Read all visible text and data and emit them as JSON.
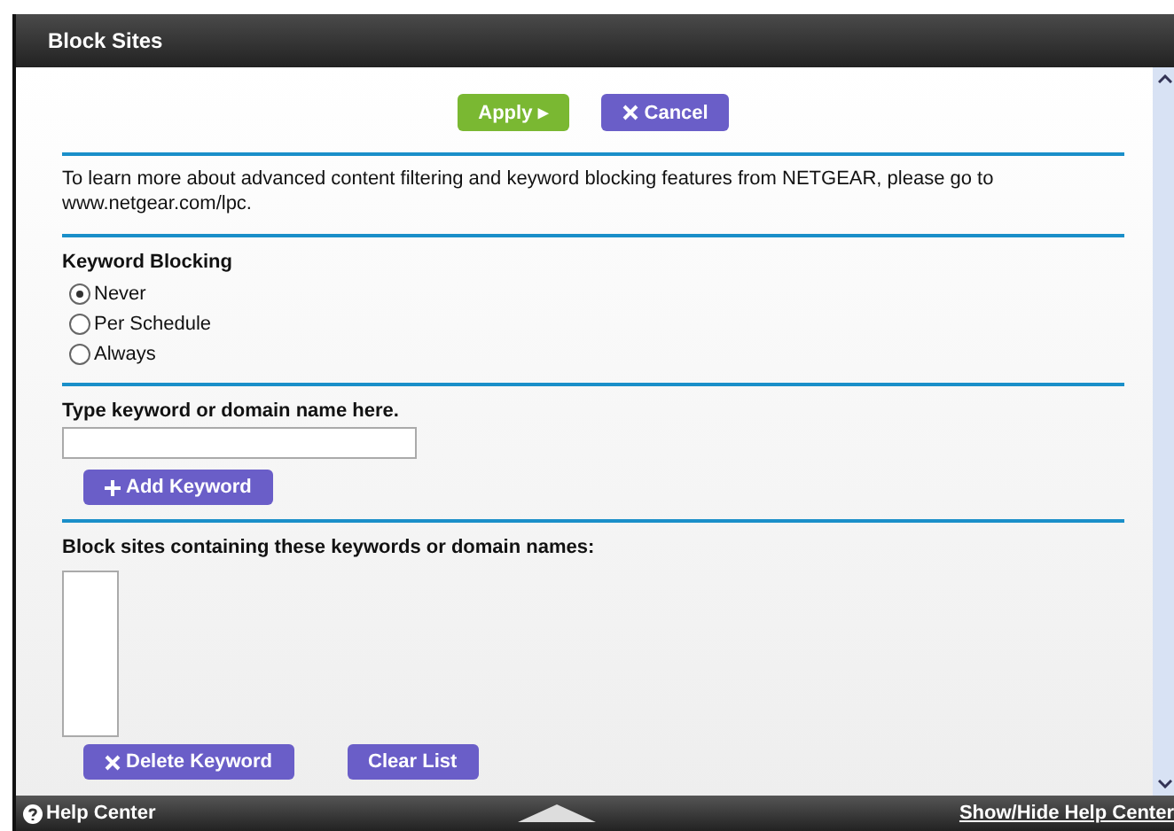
{
  "window": {
    "title": "Block Sites"
  },
  "actions": [
    {
      "label": "Apply ▸",
      "kind": "apply"
    },
    {
      "label": "Cancel",
      "kind": "cancel"
    }
  ],
  "intro": "To learn more about advanced content filtering and keyword blocking features from NETGEAR, please go to www.netgear.com/lpc.",
  "keyword_blocking": {
    "heading": "Keyword Blocking",
    "options": [
      {
        "label": "Never",
        "selected": true
      },
      {
        "label": "Per Schedule",
        "selected": false
      },
      {
        "label": "Always",
        "selected": false
      }
    ]
  },
  "keyword_entry": {
    "label": "Type keyword or domain name here.",
    "button": "Add Keyword"
  },
  "blocked_list": {
    "label": "Block sites containing these keywords or domain names:",
    "buttons": [
      {
        "label": "Delete Keyword",
        "kind": "delete"
      },
      {
        "label": "Clear List",
        "kind": "plain"
      }
    ]
  },
  "footer": {
    "help": "Help Center",
    "toggle": "Show/Hide Help Center"
  }
}
